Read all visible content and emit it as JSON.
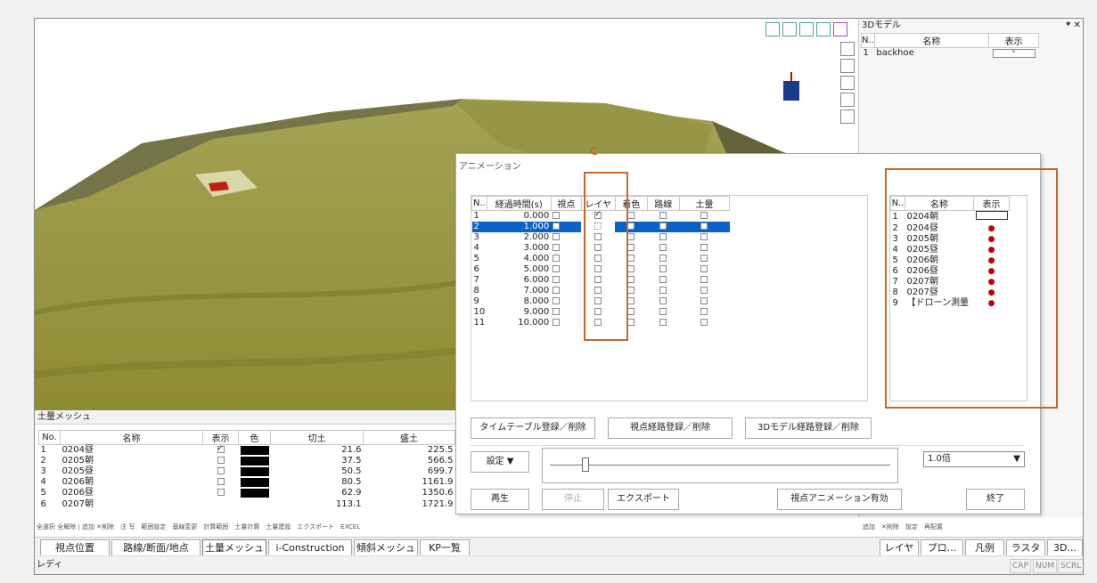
{
  "soil_panel": {
    "title": "土量メッシュ",
    "headers": [
      "No.",
      "名称",
      "表示",
      "色",
      "切土",
      "盛土"
    ],
    "rows": [
      [
        "1",
        "0204昼",
        "21.6",
        "225.5"
      ],
      [
        "2",
        "0205朝",
        "37.5",
        "566.5"
      ],
      [
        "3",
        "0205昼",
        "50.5",
        "699.7"
      ],
      [
        "4",
        "0206朝",
        "80.5",
        "1161.9"
      ],
      [
        "5",
        "0206昼",
        "62.9",
        "1350.6"
      ],
      [
        "6",
        "0207朝",
        "113.1",
        "1721.9"
      ]
    ],
    "toolbar": [
      "全選択",
      "全解除",
      "追加",
      "削除",
      "注 写",
      "範囲設定",
      "基線変更",
      "計算範囲",
      "土量計算",
      "土量建設",
      "エクスポート",
      "EXCEL"
    ]
  },
  "model_panel": {
    "title": "3Dモデル",
    "pin": "ᵠ ✕",
    "headers": [
      "N..",
      "名称",
      "表示"
    ],
    "rows": [
      [
        "1",
        "backhoe"
      ]
    ],
    "toolbar": [
      "追加",
      "削除",
      "設定",
      "再配置"
    ]
  },
  "anim": {
    "title": "アニメーション",
    "marker": "C",
    "headers": [
      "N..",
      "経過時間(s)",
      "視点",
      "レイヤ",
      "着色",
      "路線",
      "土量"
    ],
    "rows": [
      [
        "1",
        "0.000"
      ],
      [
        "2",
        "1.000"
      ],
      [
        "3",
        "2.000"
      ],
      [
        "4",
        "3.000"
      ],
      [
        "5",
        "4.000"
      ],
      [
        "6",
        "5.000"
      ],
      [
        "7",
        "6.000"
      ],
      [
        "8",
        "7.000"
      ],
      [
        "9",
        "8.000"
      ],
      [
        "10",
        "9.000"
      ],
      [
        "11",
        "10.000"
      ]
    ],
    "layer_headers": [
      "N..",
      "名称",
      "表示"
    ],
    "layers": [
      [
        "1",
        "0204朝"
      ],
      [
        "2",
        "0204昼"
      ],
      [
        "3",
        "0205朝"
      ],
      [
        "4",
        "0205昼"
      ],
      [
        "5",
        "0206朝"
      ],
      [
        "6",
        "0206昼"
      ],
      [
        "7",
        "0207朝"
      ],
      [
        "8",
        "0207昼"
      ],
      [
        "9",
        "【ドローン測量"
      ]
    ],
    "btn_timetable": "タイムテーブル登録／削除",
    "btn_viewpath": "視点経路登録／削除",
    "btn_modelpath": "3Dモデル経路登録／削除",
    "btn_settings": "設定 ▼",
    "speed": "1.0倍",
    "btn_play": "再生",
    "btn_stop": "停止",
    "btn_export": "エクスポート",
    "btn_viewanim": "視点アニメーション有効",
    "btn_close": "終了"
  },
  "tabs": [
    "視点位置",
    "路線/断面/地点",
    "土量メッシュ",
    "i-Construction",
    "傾斜メッシュ",
    "KP一覧"
  ],
  "right_tabs": [
    "レイヤ",
    "プロ...",
    "凡例",
    "ラスタ",
    "3D..."
  ],
  "status": "レディ",
  "caps": [
    "CAP",
    "NUM",
    "SCRL"
  ],
  "colors": {
    "accent": "#0a64c8",
    "highlight": "#c5682a",
    "terrain": "#9d9b3c"
  }
}
